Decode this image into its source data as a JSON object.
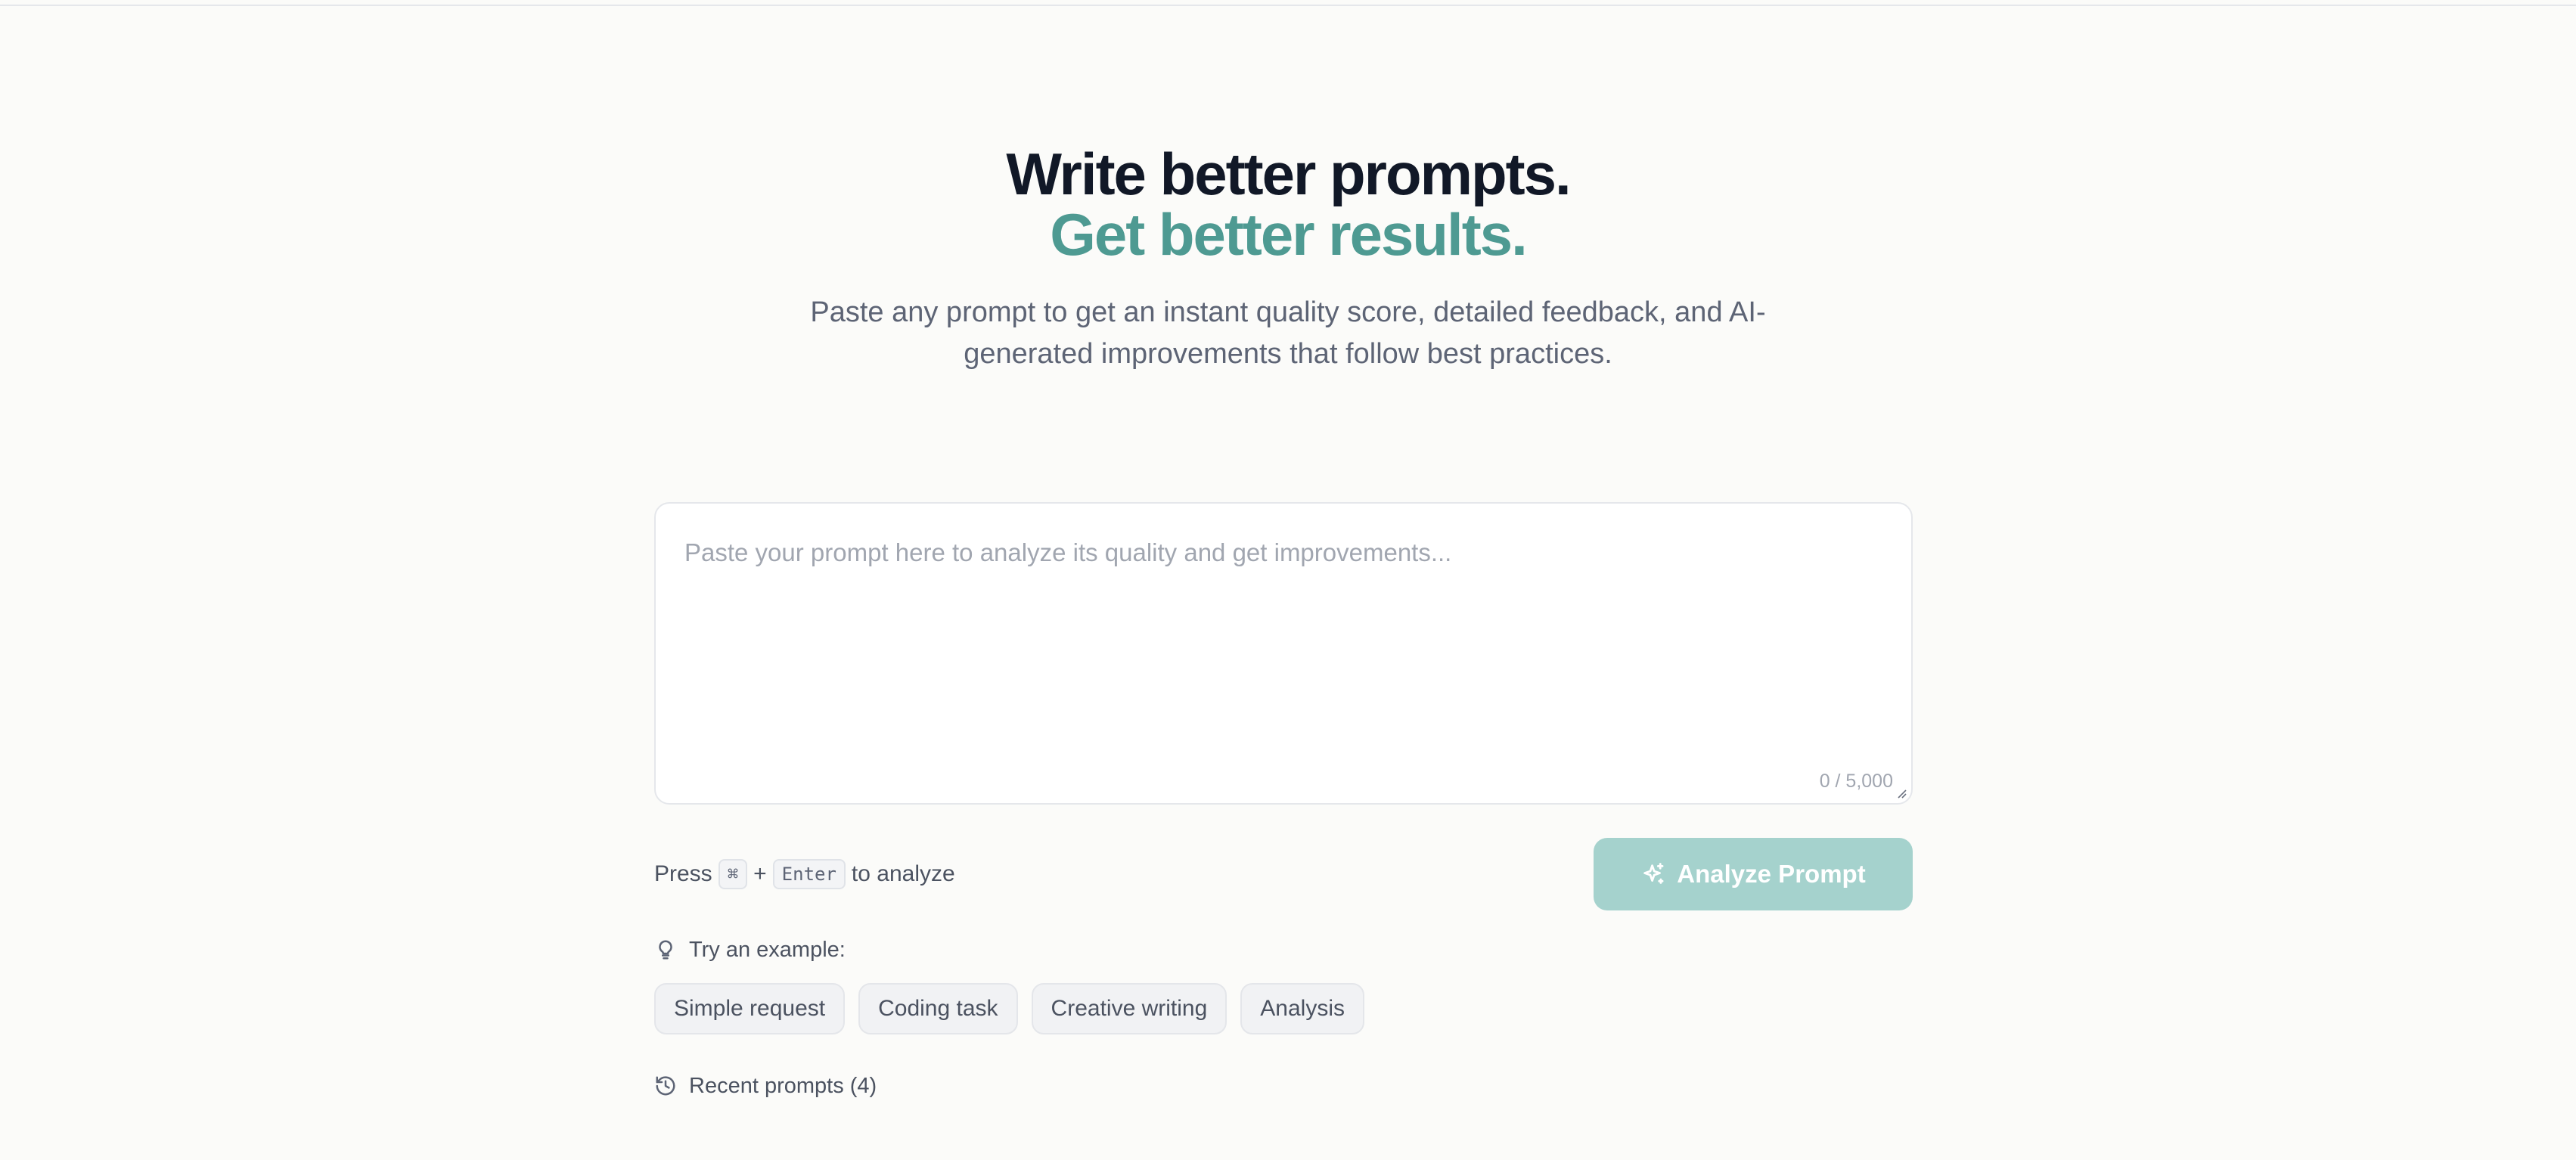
{
  "hero": {
    "title_line1": "Write better prompts.",
    "title_line2": "Get better results.",
    "subtitle": "Paste any prompt to get an instant quality score, detailed feedback, and AI-generated improvements that follow best practices."
  },
  "editor": {
    "placeholder": "Paste your prompt here to analyze its quality and get improvements...",
    "value": "",
    "counter": "0 / 5,000"
  },
  "shortcut": {
    "press": "Press",
    "key1": "⌘",
    "plus": "+",
    "key2": "Enter",
    "suffix": "to analyze"
  },
  "analyze_button": {
    "label": "Analyze Prompt",
    "icon": "sparkles-icon"
  },
  "examples": {
    "label": "Try an example:",
    "icon": "lightbulb-icon",
    "items": [
      "Simple request",
      "Coding task",
      "Creative writing",
      "Analysis"
    ]
  },
  "recent": {
    "label": "Recent prompts (4)",
    "icon": "history-icon"
  },
  "colors": {
    "accent": "#4e9a92",
    "button_disabled": "#a5d2cd",
    "background": "#fbfbf9"
  }
}
